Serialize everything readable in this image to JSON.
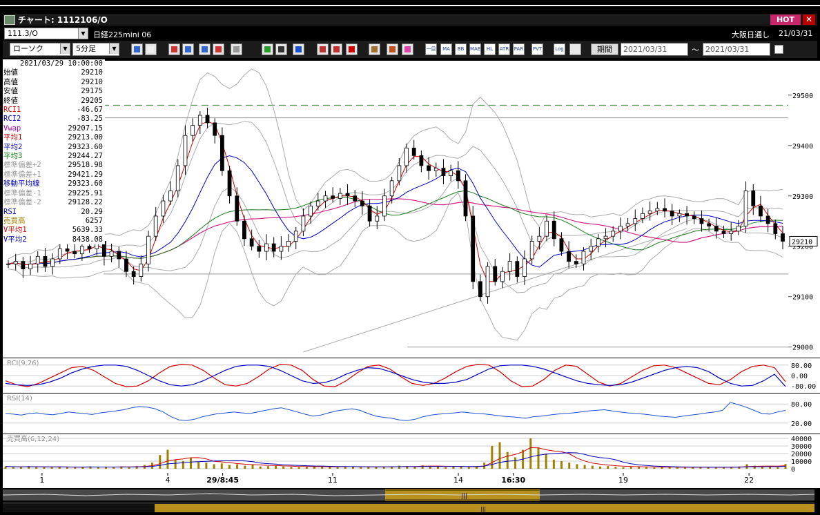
{
  "window": {
    "title": "チャート: 1112106/O",
    "hot_label": "HOT",
    "close_label": "✕"
  },
  "header": {
    "symbol_code": "111.3/O",
    "symbol_name": "日経225mini 06",
    "session": "大阪日通し",
    "date": "21/03/31"
  },
  "toolbar": {
    "chart_type": "ローソク",
    "interval": "5分足",
    "period_label": "期間",
    "date_from": "2021/03/31",
    "date_sep": "〜",
    "date_to": "2021/03/31"
  },
  "toolbar_icons": [
    "search-icon",
    "crosshair-icon",
    "arrow-down-icon",
    "zoom-in-icon",
    "zoom-out-icon",
    "flag-icon",
    "trash-icon",
    "pen-icon",
    "cursor-icon",
    "undo-icon",
    "candle-icon",
    "candle-alt-icon",
    "all-icon",
    "grid-icon",
    "wrench-icon",
    "palette-icon"
  ],
  "indicator_buttons": [
    "一目",
    "MA",
    "BB",
    "MAE",
    "HL",
    "ATR",
    "PAR",
    "PVT"
  ],
  "indicator_buttons2": [
    "Log"
  ],
  "infobox": {
    "datetime": "2021/03/29 10:00:00",
    "rows": [
      {
        "label": "始値",
        "value": "29210",
        "color": "#000000"
      },
      {
        "label": "高値",
        "value": "29210",
        "color": "#000000"
      },
      {
        "label": "安値",
        "value": "29175",
        "color": "#000000"
      },
      {
        "label": "終値",
        "value": "29205",
        "color": "#000000"
      },
      {
        "label": "RCI1",
        "value": "-46.67",
        "color": "#d00000"
      },
      {
        "label": "RCI2",
        "value": "-83.25",
        "color": "#0000c0"
      },
      {
        "label": "Vwap",
        "value": "29207.15",
        "color": "#c000c0"
      },
      {
        "label": "平均1",
        "value": "29213.00",
        "color": "#d00000"
      },
      {
        "label": "平均2",
        "value": "29323.60",
        "color": "#0000c0"
      },
      {
        "label": "平均3",
        "value": "29244.27",
        "color": "#008000"
      },
      {
        "label": "標準偏差+2",
        "value": "29518.98",
        "color": "#999999"
      },
      {
        "label": "標準偏差+1",
        "value": "29421.29",
        "color": "#999999"
      },
      {
        "label": "移動平均線",
        "value": "29323.60",
        "color": "#0000c0"
      },
      {
        "label": "標準偏差-1",
        "value": "29225.91",
        "color": "#999999"
      },
      {
        "label": "標準偏差-2",
        "value": "29128.22",
        "color": "#999999"
      },
      {
        "label": "RSI",
        "value": "20.29",
        "color": "#0000c0"
      },
      {
        "label": "売買高",
        "value": "6257",
        "color": "#a08000"
      },
      {
        "label": "V平均1",
        "value": "5639.33",
        "color": "#d00000"
      },
      {
        "label": "V平均2",
        "value": "8438.08",
        "color": "#0000c0"
      }
    ]
  },
  "chart_data": [
    {
      "type": "candlestick",
      "title": "",
      "yticks": [
        29000,
        29100,
        29200,
        29300,
        29400,
        29500
      ],
      "ylim": [
        28990,
        29560
      ],
      "current_price": 29210,
      "dashed_level": 29480,
      "xticks": [
        {
          "label": "1",
          "x": 0.05
        },
        {
          "label": "4",
          "x": 0.21
        },
        {
          "label": "29/8:45",
          "x": 0.28
        },
        {
          "label": "11",
          "x": 0.42
        },
        {
          "label": "14",
          "x": 0.58
        },
        {
          "label": "16:30",
          "x": 0.65
        },
        {
          "label": "19",
          "x": 0.79
        },
        {
          "label": "22",
          "x": 0.95
        }
      ],
      "close": [
        29165,
        29170,
        29155,
        29165,
        29180,
        29160,
        29175,
        29195,
        29190,
        29185,
        29200,
        29195,
        29210,
        29180,
        29190,
        29175,
        29150,
        29140,
        29165,
        29220,
        29260,
        29290,
        29310,
        29360,
        29420,
        29440,
        29460,
        29445,
        29420,
        29350,
        29300,
        29250,
        29215,
        29200,
        29190,
        29205,
        29190,
        29200,
        29210,
        29230,
        29260,
        29280,
        29290,
        29300,
        29295,
        29305,
        29300,
        29290,
        29280,
        29250,
        29260,
        29300,
        29330,
        29360,
        29395,
        29380,
        29360,
        29350,
        29355,
        29340,
        29350,
        29330,
        29260,
        29130,
        29100,
        29160,
        29130,
        29150,
        29170,
        29140,
        29175,
        29210,
        29220,
        29250,
        29215,
        29190,
        29170,
        29165,
        29190,
        29200,
        29215,
        29220,
        29230,
        29240,
        29245,
        29255,
        29265,
        29270,
        29275,
        29270,
        29260,
        29265,
        29260,
        29255,
        29245,
        29240,
        29230,
        29225,
        29230,
        29240,
        29310,
        29280,
        29260,
        29245,
        29225,
        29210
      ]
    },
    {
      "type": "line",
      "title": "RCI(9,26)",
      "yticks": [
        "80.00",
        "0.00",
        "-80.00"
      ],
      "series": [
        {
          "name": "RCI1",
          "color": "#d00000",
          "values": [
            -40,
            -70,
            -85,
            -60,
            -20,
            20,
            60,
            70,
            40,
            -10,
            -60,
            -85,
            -80,
            -40,
            20,
            70,
            85,
            80,
            40,
            -20,
            -70,
            -80,
            -60,
            -10,
            50,
            85,
            80,
            40,
            -30,
            -80,
            -85,
            -40,
            20,
            70,
            80,
            50,
            -10,
            -60,
            -75,
            -60,
            -20,
            30,
            70,
            85,
            80,
            30,
            -40,
            -85,
            -80,
            -30,
            40,
            80,
            70,
            10,
            -50,
            -80,
            -60,
            -10,
            40,
            75,
            80,
            60,
            20,
            -20,
            -60,
            -70,
            -30,
            30,
            70,
            80,
            60,
            -47
          ]
        },
        {
          "name": "RCI2",
          "color": "#0000c0",
          "values": [
            -60,
            -70,
            -75,
            -70,
            -50,
            -20,
            20,
            50,
            70,
            80,
            80,
            70,
            40,
            0,
            -40,
            -70,
            -80,
            -70,
            -40,
            0,
            40,
            70,
            80,
            80,
            70,
            40,
            0,
            -40,
            -60,
            -55,
            -30,
            10,
            40,
            60,
            55,
            30,
            0,
            -30,
            -50,
            -60,
            -60,
            -50,
            -30,
            10,
            50,
            75,
            80,
            80,
            70,
            50,
            20,
            -10,
            -40,
            -60,
            -70,
            -75,
            -70,
            -50,
            -20,
            10,
            40,
            60,
            70,
            60,
            30,
            -20,
            -60,
            -80,
            -75,
            -40,
            10,
            -83
          ]
        }
      ]
    },
    {
      "type": "line",
      "title": "RSI(14)",
      "yticks": [
        "80.00",
        "20.00"
      ],
      "series": [
        {
          "name": "RSI",
          "color": "#1a4fd0",
          "values": [
            50,
            48,
            45,
            50,
            52,
            48,
            46,
            50,
            55,
            52,
            50,
            47,
            52,
            55,
            58,
            62,
            68,
            72,
            70,
            65,
            55,
            40,
            30,
            28,
            32,
            40,
            45,
            50,
            52,
            55,
            52,
            50,
            55,
            60,
            65,
            68,
            62,
            55,
            48,
            42,
            45,
            52,
            58,
            62,
            65,
            60,
            50,
            42,
            38,
            35,
            30,
            28,
            32,
            40,
            45,
            48,
            50,
            52,
            55,
            52,
            50,
            48,
            45,
            42,
            40,
            38,
            35,
            40,
            42,
            45,
            48,
            50,
            52,
            55,
            58,
            60,
            62,
            58,
            55,
            52,
            50,
            48,
            45,
            42,
            40,
            38,
            42,
            45,
            48,
            52,
            55,
            60,
            85,
            78,
            70,
            60,
            50,
            48,
            55,
            60
          ]
        }
      ]
    },
    {
      "type": "bar",
      "title": "売買高(6,12,24)",
      "yticks": [
        "40000",
        "30000",
        "20000",
        "10000",
        "0"
      ],
      "series": [
        {
          "name": "売買高",
          "color": "#a08000",
          "values": [
            3000,
            2500,
            2000,
            3500,
            2000,
            1800,
            2200,
            2500,
            2000,
            1500,
            2500,
            3000,
            2000,
            2500,
            2000,
            3000,
            2500,
            3500,
            5000,
            8000,
            18000,
            25000,
            12000,
            10000,
            14000,
            9000,
            8000,
            6000,
            7000,
            5000,
            6000,
            4000,
            5000,
            3000,
            3500,
            4000,
            3000,
            2500,
            2000,
            2500,
            3000,
            3500,
            2500,
            2000,
            3000,
            2500,
            2000,
            3000,
            2500,
            2000,
            3000,
            4000,
            3500,
            3000,
            4500,
            3500,
            3000,
            2000,
            3000,
            2500,
            2000,
            3000,
            8000,
            30000,
            35000,
            22000,
            15000,
            25000,
            40000,
            28000,
            20000,
            12000,
            10000,
            8000,
            6000,
            5000,
            4000,
            3000,
            3500,
            2500,
            2000,
            3000,
            2500,
            2000,
            1500,
            2000,
            2500,
            2000,
            1500,
            2000,
            2500,
            2000,
            1500,
            2000,
            2500,
            3000,
            6000,
            4000,
            3000,
            2500,
            2000,
            6257
          ]
        }
      ]
    }
  ]
}
